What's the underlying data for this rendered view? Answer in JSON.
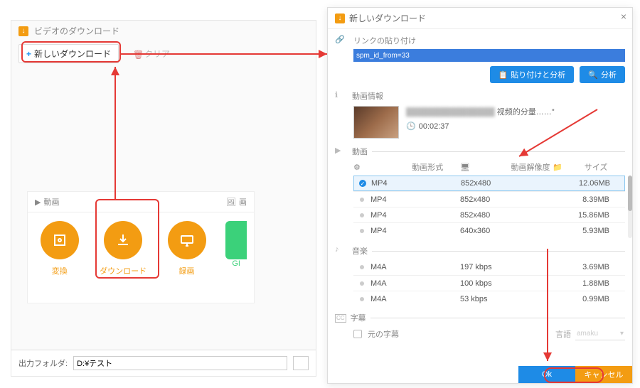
{
  "left": {
    "title": "ビデオのダウンロード",
    "new_download": "新しいダウンロード",
    "clear": "クリア",
    "tabs": {
      "video": "動画",
      "image": "画"
    },
    "tiles": [
      {
        "label": "変換"
      },
      {
        "label": "ダウンロード"
      },
      {
        "label": "録画"
      },
      {
        "label": "GI"
      }
    ],
    "output_folder_label": "出力フォルダ:",
    "output_folder_value": "D:¥テスト"
  },
  "right": {
    "title": "新しいダウンロード",
    "paste_section": "リンクの貼り付け",
    "url_value": "spm_id_from=33",
    "paste_analyze_btn": "貼り付けと分析",
    "analyze_btn": "分析",
    "video_info_label": "動画情報",
    "meta_suffix": "视频的分量……\"",
    "duration": "00:02:37",
    "video_section": "動画",
    "headers": {
      "format": "動画形式",
      "res": "動画解像度",
      "size": "サイズ"
    },
    "video_rows": [
      {
        "fmt": "MP4",
        "res": "852x480",
        "size": "12.06MB",
        "selected": true
      },
      {
        "fmt": "MP4",
        "res": "852x480",
        "size": "8.39MB"
      },
      {
        "fmt": "MP4",
        "res": "852x480",
        "size": "15.86MB"
      },
      {
        "fmt": "MP4",
        "res": "640x360",
        "size": "5.93MB"
      }
    ],
    "audio_section": "音楽",
    "audio_rows": [
      {
        "fmt": "M4A",
        "res": "197 kbps",
        "size": "3.69MB"
      },
      {
        "fmt": "M4A",
        "res": "100 kbps",
        "size": "1.88MB"
      },
      {
        "fmt": "M4A",
        "res": "53 kbps",
        "size": "0.99MB"
      }
    ],
    "subtitle_section": "字幕",
    "original_subtitle": "元の字幕",
    "language_label": "言語",
    "language_value": "amaku",
    "ok": "Ok",
    "cancel": "キャンセル"
  }
}
